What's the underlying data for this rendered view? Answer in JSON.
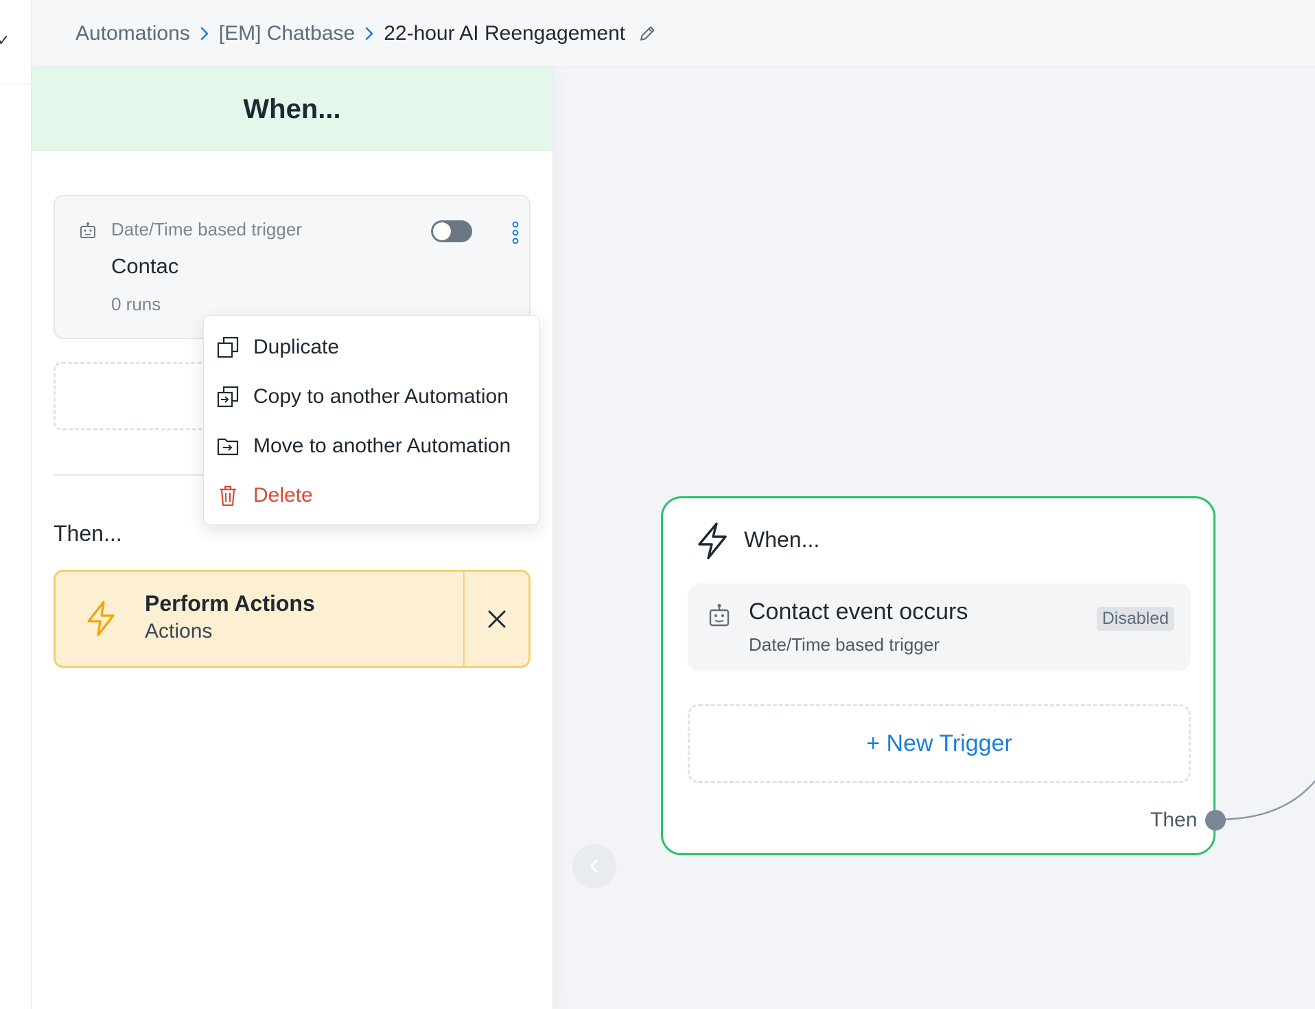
{
  "breadcrumb": {
    "items": [
      "Automations",
      "[EM] Chatbase",
      "22-hour AI Reengagement"
    ]
  },
  "panel": {
    "title": "When...",
    "trigger": {
      "type": "Date/Time based trigger",
      "name": "Contac",
      "runs": "0 runs",
      "enabled": false
    },
    "then_label": "Then...",
    "action": {
      "title": "Perform Actions",
      "subtitle": "Actions"
    }
  },
  "menu": {
    "items": [
      {
        "label": "Duplicate",
        "icon": "duplicate-icon"
      },
      {
        "label": "Copy to another Automation",
        "icon": "copy-to-icon"
      },
      {
        "label": "Move to another Automation",
        "icon": "move-folder-icon"
      },
      {
        "label": "Delete",
        "icon": "trash-icon"
      }
    ]
  },
  "node": {
    "title": "When...",
    "trigger": {
      "name": "Contact event occurs",
      "type": "Date/Time based trigger",
      "badge": "Disabled"
    },
    "new_trigger": "+ New Trigger",
    "then": "Then"
  },
  "colors": {
    "accent_blue": "#1a7fdb",
    "node_border": "#27c26a",
    "panel_head": "#e3f8ea",
    "action_bg": "#fdefd2",
    "action_border": "#f6cf6e",
    "danger": "#dc4a33"
  }
}
